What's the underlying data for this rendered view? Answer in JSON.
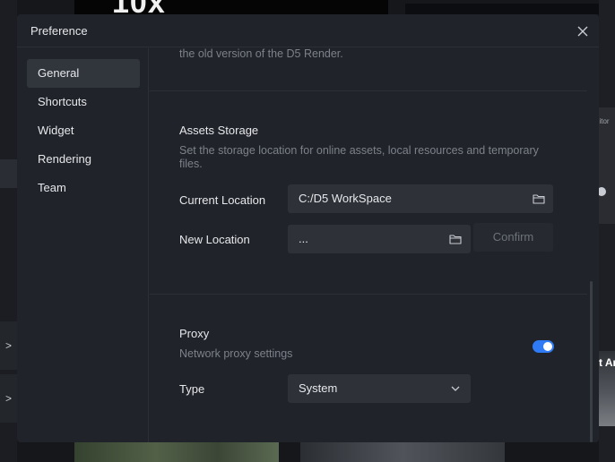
{
  "background": {
    "top_text": "10x",
    "right_panel_text": "ditor",
    "right_image_text": "t Ar",
    "left_arrows": [
      ">",
      ">"
    ]
  },
  "dialog": {
    "title": "Preference",
    "close_icon": "close-icon"
  },
  "sidebar": {
    "items": [
      {
        "label": "General",
        "active": true
      },
      {
        "label": "Shortcuts",
        "active": false
      },
      {
        "label": "Widget",
        "active": false
      },
      {
        "label": "Rendering",
        "active": false
      },
      {
        "label": "Team",
        "active": false
      }
    ]
  },
  "general": {
    "top_note": "the old version of the D5 Render.",
    "assets_storage": {
      "title": "Assets Storage",
      "description_line1": "Set the storage location for online assets, local resources and temporary",
      "description_line2": "files.",
      "current_location_label": "Current Location",
      "current_location_value": "C:/D5 WorkSpace",
      "new_location_label": "New Location",
      "new_location_value": "...",
      "confirm_label": "Confirm",
      "folder_icon": "folder-icon"
    },
    "proxy": {
      "title": "Proxy",
      "description": "Network proxy settings",
      "enabled": true,
      "type_label": "Type",
      "type_value": "System",
      "dropdown_icon": "chevron-down-icon"
    }
  },
  "colors": {
    "accent": "#2f7bf6",
    "dialog_bg": "#202329",
    "field_bg": "#2e3137",
    "active_nav_bg": "#31353c"
  }
}
